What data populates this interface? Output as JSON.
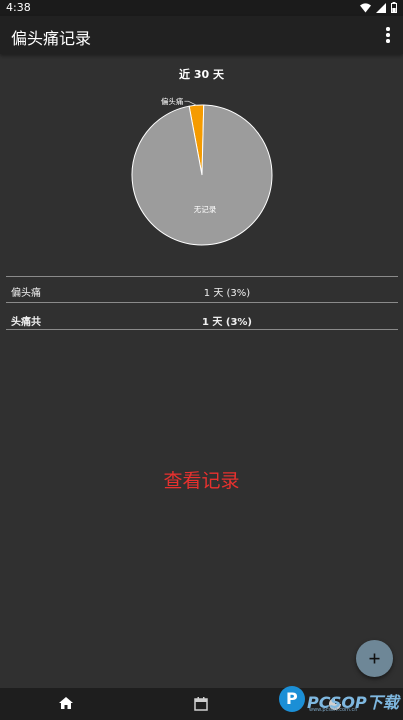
{
  "status_bar": {
    "time": "4:38"
  },
  "app_bar": {
    "title": "偏头痛记录",
    "menu_icon": "overflow-menu-icon"
  },
  "chart_title": "近 30 天",
  "chart_data": {
    "type": "pie",
    "title": "近 30 天",
    "slices": [
      {
        "label": "偏头痛",
        "value": 1,
        "color": "#f59b00"
      },
      {
        "label": "无记录",
        "value": 29,
        "color": "#9c9c9c"
      }
    ]
  },
  "summary": {
    "rows": [
      {
        "label": "偏头痛",
        "value": "1 天 (3%)"
      },
      {
        "label": "头痛共",
        "value": "1 天 (3%)"
      }
    ]
  },
  "view_records_label": "查看记录",
  "fab": {
    "icon": "plus-icon"
  },
  "bottom_nav": [
    {
      "icon": "home-icon",
      "active": true
    },
    {
      "icon": "calendar-icon",
      "active": false
    },
    {
      "icon": "pie-chart-icon",
      "active": false
    }
  ],
  "watermark": {
    "text": "PCSOP下载",
    "sub": "www.pcsoft.com.cn"
  },
  "colors": {
    "accent_red": "#e8312e",
    "fab": "#6e8797",
    "background": "#303030"
  }
}
